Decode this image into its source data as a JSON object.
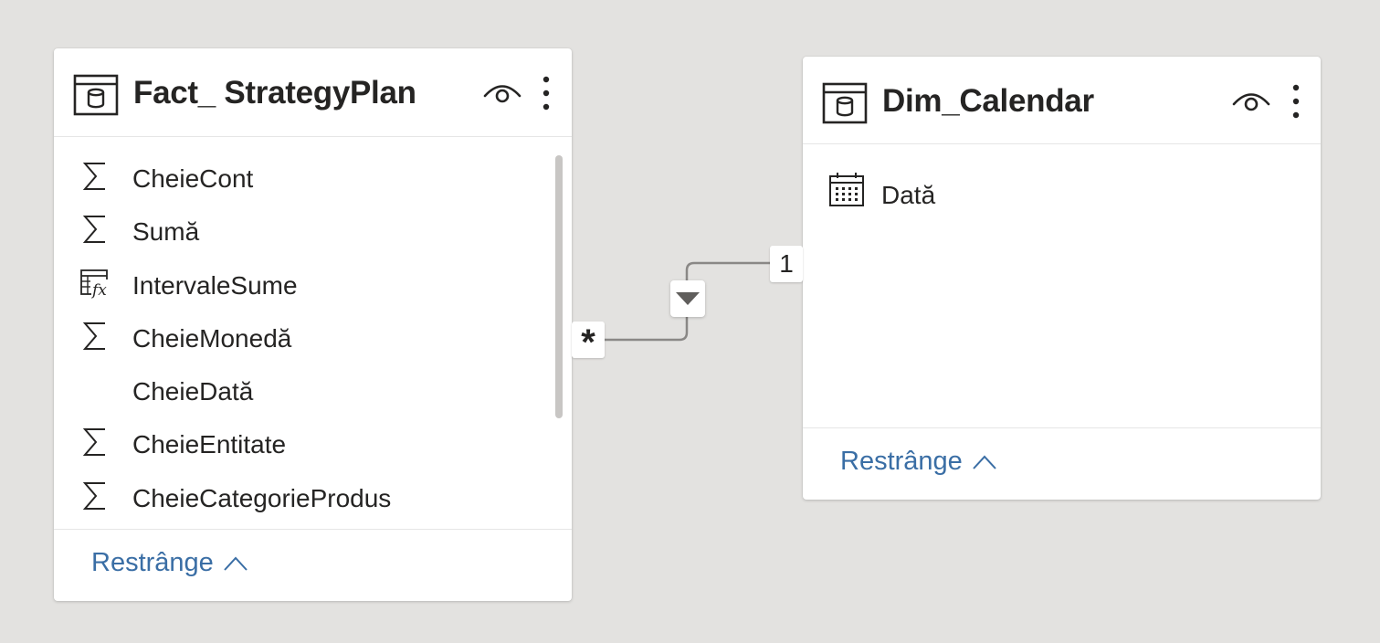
{
  "tables": [
    {
      "title": "Fact_ StrategyPlan",
      "fields": [
        {
          "label": "CheieCont",
          "icon": "sigma-icon"
        },
        {
          "label": "Sumă",
          "icon": "sigma-icon"
        },
        {
          "label": "IntervaleSume",
          "icon": "calculated-column-icon"
        },
        {
          "label": "CheieMonedă",
          "icon": "sigma-icon"
        },
        {
          "label": "CheieDată",
          "icon": "none"
        },
        {
          "label": "CheieEntitate",
          "icon": "sigma-icon"
        },
        {
          "label": "CheieCategorieProdus",
          "icon": "sigma-icon"
        }
      ],
      "collapse_label": "Restrânge"
    },
    {
      "title": "Dim_Calendar",
      "fields": [
        {
          "label": "Dată",
          "icon": "calendar-icon"
        }
      ],
      "collapse_label": "Restrânge"
    }
  ],
  "relationship": {
    "from_cardinality": "*",
    "to_cardinality": "1",
    "filter_direction": "single"
  },
  "colors": {
    "canvas": "#e3e2e0",
    "card": "#ffffff",
    "link_text": "#3a6ea5",
    "line": "#8a8886"
  }
}
